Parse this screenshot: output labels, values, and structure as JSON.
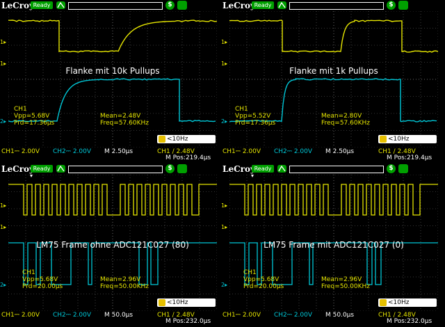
{
  "scopes": [
    {
      "brand": "LeCroy",
      "status": "Ready",
      "label": "Flanke mit 10k Pullups",
      "measure": {
        "ch": "CH1",
        "vpp": "Vpp=5.68V",
        "prd": "Prd=17.36µs",
        "mean": "Mean=2.48V",
        "freq": "Freq=57.60KHz"
      },
      "bw": "<10Hz",
      "footer": {
        "ch1": "CH1⎓ 2.00V",
        "ch2": "CH2⎓ 2.00V",
        "tb": "M 2.50µs",
        "trig": "CH1 ∕ 2.48V",
        "mpos": "M Pos:219.4µs"
      },
      "markers": {
        "ch1": "1▸",
        "ch2": "2▸"
      }
    },
    {
      "brand": "LeCroy",
      "status": "Ready",
      "label": "Flanke mit 1k Pullups",
      "measure": {
        "ch": "CH1",
        "vpp": "Vpp=5.52V",
        "prd": "Prd=17.36µs",
        "mean": "Mean=2.80V",
        "freq": "Freq=57.60KHz"
      },
      "bw": "<10Hz",
      "footer": {
        "ch1": "CH1⎓ 2.00V",
        "ch2": "CH2⎓ 2.00V",
        "tb": "M 2.50µs",
        "trig": "CH1 ∕ 2.48V",
        "mpos": "M Pos:219.4µs"
      },
      "markers": {
        "ch1": "1▸",
        "ch2": "2▸"
      }
    },
    {
      "brand": "LeCroy",
      "status": "Ready",
      "label": "LM75 Frame ohne ADC121C027 (80)",
      "measure": {
        "ch": "CH1",
        "vpp": "Vpp=5.68V",
        "prd": "Prd=20.00µs",
        "mean": "Mean=2.96V",
        "freq": "Freq=50.00KHz"
      },
      "bw": "<10Hz",
      "footer": {
        "ch1": "CH1⎓ 2.00V",
        "ch2": "CH2⎓ 2.00V",
        "tb": "M 50.0µs",
        "trig": "CH1 ∕ 2.48V",
        "mpos": "M Pos:232.0µs"
      },
      "markers": {
        "ch1": "1▸",
        "ch2": "2▸"
      }
    },
    {
      "brand": "LeCroy",
      "status": "Ready",
      "label": "LM75 Frame mit ADC121C027 (0)",
      "measure": {
        "ch": "CH1",
        "vpp": "Vpp=5.68V",
        "prd": "Prd=20.00µs",
        "mean": "Mean=2.96V",
        "freq": "Freq=50.00KHz"
      },
      "bw": "<10Hz",
      "footer": {
        "ch1": "CH1⎓ 2.00V",
        "ch2": "CH2⎓ 2.00V",
        "tb": "M 50.0µs",
        "trig": "CH1 ∕ 2.48V",
        "mpos": "M Pos:232.0µs"
      },
      "markers": {
        "ch1": "1▸",
        "ch2": "2▸"
      }
    }
  ],
  "colors": {
    "ch1": "#e6e600",
    "ch2": "#00c8d8",
    "grid": "#6a6a6a",
    "accent": "#00a000"
  },
  "icons": [
    "trigger-icon",
    "save-icon",
    "menu-icon"
  ]
}
